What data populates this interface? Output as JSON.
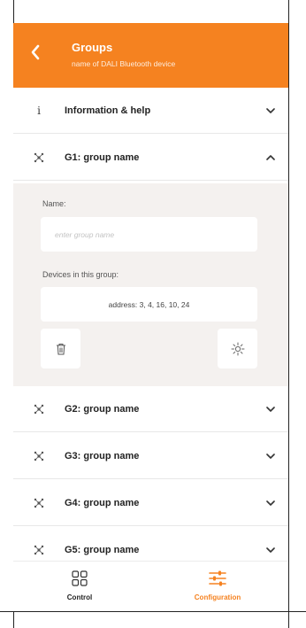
{
  "header": {
    "title": "Groups",
    "subtitle": "name of DALI Bluetooth device"
  },
  "info_row": {
    "label": "Information & help"
  },
  "groups": [
    {
      "label": "G1: group name",
      "expanded": true
    },
    {
      "label": "G2: group name",
      "expanded": false
    },
    {
      "label": "G3: group name",
      "expanded": false
    },
    {
      "label": "G4: group name",
      "expanded": false
    },
    {
      "label": "G5: group name",
      "expanded": false
    }
  ],
  "group_detail": {
    "name_label": "Name:",
    "name_placeholder": "enter group name",
    "name_value": "",
    "devices_label": "Devices in this group:",
    "devices_value": "address: 3, 4, 16, 10, 24"
  },
  "tabbar": {
    "control_label": "Control",
    "configuration_label": "Configuration",
    "active_tab": "configuration"
  },
  "colors": {
    "accent": "#f58220",
    "expanded_bg": "#f4f1ef",
    "text_dark": "#222222",
    "text_muted": "#555555"
  },
  "icons": {
    "back": "chevron-left-icon",
    "info": "info-icon",
    "group": "group-nodes-icon",
    "chevron_down": "chevron-down-icon",
    "chevron_up": "chevron-up-icon",
    "delete": "trash-icon",
    "identify": "light-bulb-sun-icon",
    "control_tab": "grid-icon",
    "configuration_tab": "sliders-icon"
  }
}
